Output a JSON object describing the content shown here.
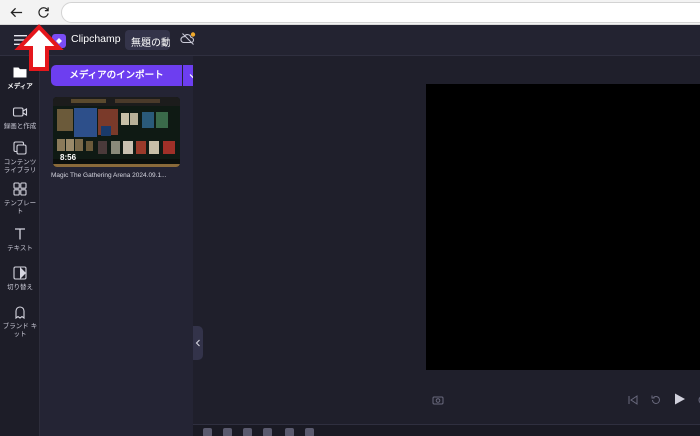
{
  "app": {
    "name": "Clipchamp",
    "project_title": "無題の動",
    "accent_color": "#6d3ef0"
  },
  "browser": {
    "back_icon": "arrow-left-icon",
    "reload_icon": "reload-icon"
  },
  "sidebar": {
    "items": [
      {
        "label": "メディア",
        "icon": "folder-icon",
        "active": true
      },
      {
        "label": "録画と作成",
        "icon": "video-camera-icon",
        "active": false
      },
      {
        "label": "コンテンツ\nライブラリ",
        "icon": "content-library-icon",
        "active": false
      },
      {
        "label": "テンプレー\nト",
        "icon": "templates-icon",
        "active": false
      },
      {
        "label": "テキスト",
        "icon": "text-icon",
        "active": false
      },
      {
        "label": "切り替え",
        "icon": "transitions-icon",
        "active": false
      },
      {
        "label": "ブランド キ\nット",
        "icon": "brand-kit-icon",
        "active": false
      }
    ]
  },
  "media_panel": {
    "import_label": "メディアのインポート",
    "items": [
      {
        "duration": "8:56",
        "caption": "Magic The Gathering Arena 2024.09.1..."
      }
    ]
  }
}
